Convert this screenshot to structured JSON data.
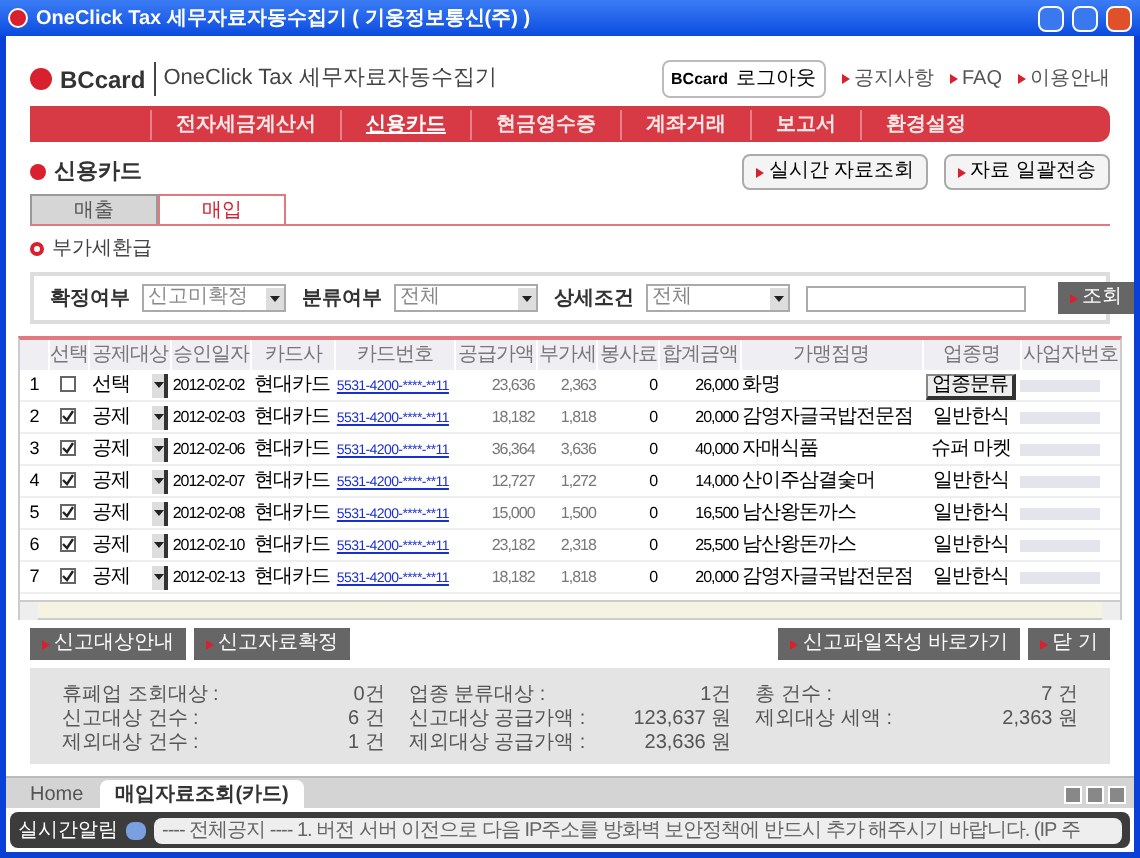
{
  "window": {
    "title": "OneClick Tax 세무자료자동수집기 ( 기웅정보통신(주) )"
  },
  "header": {
    "brand": "BCcard",
    "app_name": "OneClick Tax 세무자료자동수집기",
    "user": "BCcard",
    "logout": "로그아웃",
    "links": [
      "공지사항",
      "FAQ",
      "이용안내"
    ]
  },
  "nav": [
    {
      "label": "전자세금계산서",
      "selected": false
    },
    {
      "label": "신용카드",
      "selected": true
    },
    {
      "label": "현금영수증",
      "selected": false
    },
    {
      "label": "계좌거래",
      "selected": false
    },
    {
      "label": "보고서",
      "selected": false
    },
    {
      "label": "환경설정",
      "selected": false
    }
  ],
  "page_title": "신용카드",
  "page_buttons": [
    "실시간 자료조회",
    "자료 일괄전송"
  ],
  "tabs": [
    {
      "label": "매출",
      "selected": false
    },
    {
      "label": "매입",
      "selected": true
    }
  ],
  "section_title": "부가세환급",
  "filters": [
    {
      "label": "확정여부",
      "value": "신고미확정"
    },
    {
      "label": "분류여부",
      "value": "전체"
    },
    {
      "label": "상세조건",
      "value": "전체"
    }
  ],
  "search_button": "조회",
  "table": {
    "columns": [
      "선택",
      "공제대상",
      "승인일자",
      "카드사",
      "카드번호",
      "공급가액",
      "부가세",
      "봉사료",
      "합계금액",
      "가맹점명",
      "업종명",
      "사업자번호"
    ],
    "rows": [
      {
        "no": "1",
        "checked": false,
        "deduction": "선택",
        "date": "2012-02-02",
        "issuer": "현대카드",
        "card": "5531-4200-****-**11",
        "supply": "23,636",
        "vat": "2,363",
        "service": "0",
        "total": "26,000",
        "merchant": "화명",
        "industry": {
          "kind": "button",
          "text": "업종분류"
        }
      },
      {
        "no": "2",
        "checked": true,
        "deduction": "공제",
        "date": "2012-02-03",
        "issuer": "현대카드",
        "card": "5531-4200-****-**11",
        "supply": "18,182",
        "vat": "1,818",
        "service": "0",
        "total": "20,000",
        "merchant": "감영자글국밥전문점",
        "industry": {
          "kind": "text",
          "text": "일반한식"
        }
      },
      {
        "no": "3",
        "checked": true,
        "deduction": "공제",
        "date": "2012-02-06",
        "issuer": "현대카드",
        "card": "5531-4200-****-**11",
        "supply": "36,364",
        "vat": "3,636",
        "service": "0",
        "total": "40,000",
        "merchant": "자매식품",
        "industry": {
          "kind": "text",
          "text": "슈퍼 마켓"
        }
      },
      {
        "no": "4",
        "checked": true,
        "deduction": "공제",
        "date": "2012-02-07",
        "issuer": "현대카드",
        "card": "5531-4200-****-**11",
        "supply": "12,727",
        "vat": "1,272",
        "service": "0",
        "total": "14,000",
        "merchant": "산이주삼결숯머",
        "industry": {
          "kind": "text",
          "text": "일반한식"
        }
      },
      {
        "no": "5",
        "checked": true,
        "deduction": "공제",
        "date": "2012-02-08",
        "issuer": "현대카드",
        "card": "5531-4200-****-**11",
        "supply": "15,000",
        "vat": "1,500",
        "service": "0",
        "total": "16,500",
        "merchant": "남산왕돈까스",
        "industry": {
          "kind": "text",
          "text": "일반한식"
        }
      },
      {
        "no": "6",
        "checked": true,
        "deduction": "공제",
        "date": "2012-02-10",
        "issuer": "현대카드",
        "card": "5531-4200-****-**11",
        "supply": "23,182",
        "vat": "2,318",
        "service": "0",
        "total": "25,500",
        "merchant": "남산왕돈까스",
        "industry": {
          "kind": "text",
          "text": "일반한식"
        }
      },
      {
        "no": "7",
        "checked": true,
        "deduction": "공제",
        "date": "2012-02-13",
        "issuer": "현대카드",
        "card": "5531-4200-****-**11",
        "supply": "18,182",
        "vat": "1,818",
        "service": "0",
        "total": "20,000",
        "merchant": "감영자글국밥전문점",
        "industry": {
          "kind": "text",
          "text": "일반한식"
        }
      }
    ]
  },
  "left_buttons": [
    "신고대상안내",
    "신고자료확정"
  ],
  "right_buttons": [
    "신고파일작성 바로가기",
    "닫 기"
  ],
  "summary": [
    [
      {
        "label": "휴폐업 조회대상 :",
        "value": "0건"
      },
      {
        "label": "신고대상 건수 :",
        "value": "6 건"
      },
      {
        "label": "제외대상 건수 :",
        "value": "1 건"
      }
    ],
    [
      {
        "label": "업종 분류대상 :",
        "value": "1건"
      },
      {
        "label": "신고대상 공급가액 :",
        "value": "123,637 원"
      },
      {
        "label": "제외대상 공급가액 :",
        "value": "23,636 원"
      }
    ],
    [
      {
        "label": "총 건수 :",
        "value": "7 건"
      },
      {
        "label": "제외대상 세액 :",
        "value": "2,363 원"
      }
    ]
  ],
  "bottom_tabs": [
    {
      "label": "Home",
      "selected": false
    },
    {
      "label": "매입자료조회(카드)",
      "selected": true
    }
  ],
  "ticker": {
    "label": "실시간알림",
    "text": "---- 전체공지 ---- 1. 버전 서버 이전으로 다음 IP주소를 방화벽 보안정책에 반드시 추가 해주시기 바랍니다. (IP 주"
  }
}
